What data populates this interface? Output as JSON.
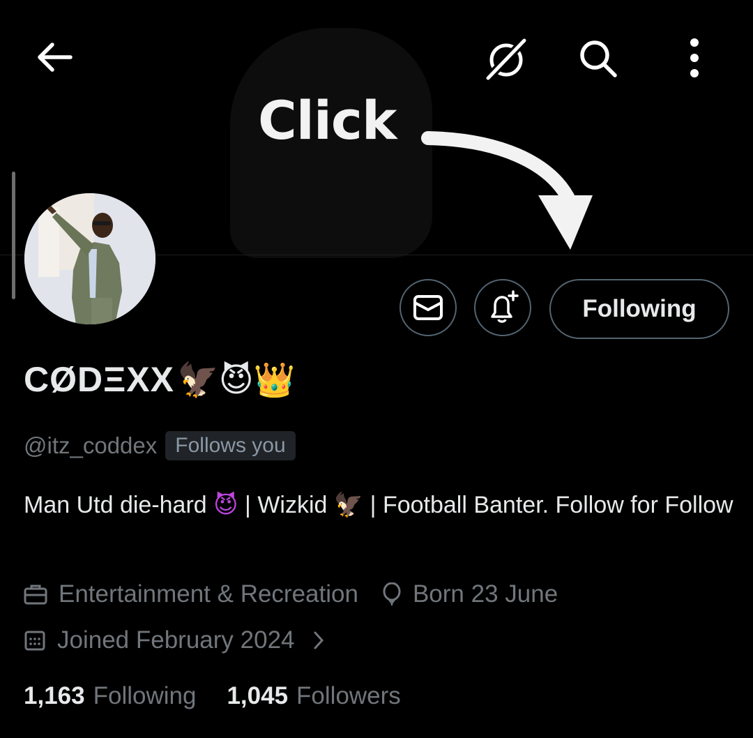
{
  "banner": {
    "overlay_text": "Click"
  },
  "header": {
    "back_icon": "arrow-left-icon",
    "grok_icon": "grok-icon",
    "search_icon": "search-icon",
    "more_icon": "more-vertical-icon"
  },
  "actions": {
    "message_icon": "envelope-icon",
    "notify_icon": "bell-plus-icon",
    "follow_label": "Following"
  },
  "profile": {
    "display_name": "CØDΞXX",
    "name_emojis": "🦅😈👑",
    "handle": "@itz_coddex",
    "follows_you": "Follows you",
    "bio_part1": "Man Utd die-hard ",
    "bio_emoji1": "😈",
    "bio_part2": " | Wizkid ",
    "bio_emoji2": "🦅",
    "bio_part3": " | Football Banter. Follow for Follow",
    "category": "Entertainment & Recreation",
    "birthday": "Born 23 June",
    "joined": "Joined February 2024"
  },
  "stats": {
    "following_count": "1,163",
    "following_label": "Following",
    "followers_count": "1,045",
    "followers_label": "Followers"
  },
  "colors": {
    "background": "#000000",
    "text": "#e7e9ea",
    "muted": "#71767b",
    "border": "#536471"
  }
}
